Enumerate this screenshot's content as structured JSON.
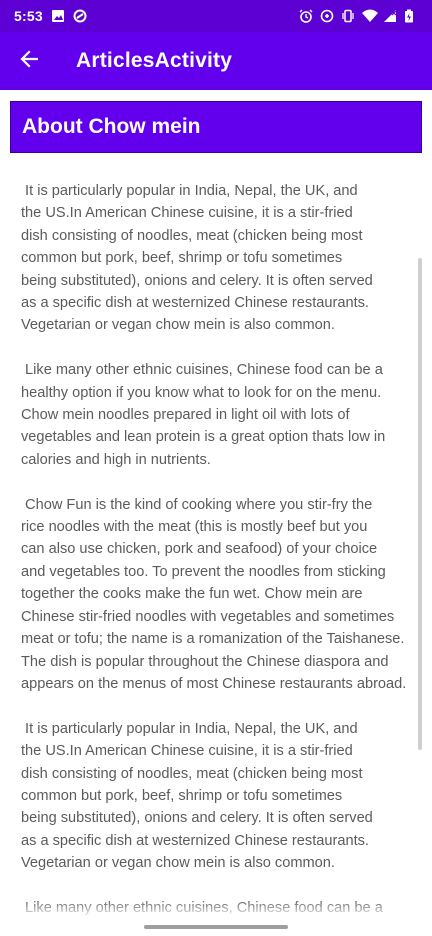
{
  "status_bar": {
    "time": "5:53",
    "icons": [
      "image-icon",
      "data-saver-icon",
      "alarm-icon",
      "data-icon",
      "vibrate-icon",
      "wifi-icon",
      "signal-icon",
      "battery-charging-icon"
    ]
  },
  "app_bar": {
    "title": "ArticlesActivity",
    "back_icon": "arrow-back-icon"
  },
  "article": {
    "heading": "About Chow mein",
    "paragraphs": [
      {
        "lines": [
          " It is particularly popular in India, Nepal, the UK, and",
          "the US.In American Chinese cuisine, it is a stir-fried",
          "dish consisting of noodles, meat (chicken being most",
          "common but pork, beef, shrimp or tofu sometimes",
          "being substituted), onions and celery. It is often served",
          "as a specific dish at westernized Chinese restaurants.",
          "Vegetarian or vegan chow mein is also common."
        ]
      },
      {
        "lines": [
          " Like many other ethnic cuisines, Chinese food can be a",
          "healthy option if you know what to look for on the menu.",
          "Chow mein noodles prepared in light oil with lots of",
          "vegetables and lean protein is a great option thats low in",
          "calories and high in nutrients."
        ]
      },
      {
        "lines": [
          " Chow Fun is the kind of cooking where you stir-fry the",
          "rice noodles with the meat (this is mostly beef but you",
          "can also use chicken, pork and seafood) of your choice",
          "and vegetables too. To prevent the noodles from sticking",
          "together the cooks make the fun wet. Chow mein are",
          "Chinese stir-fried noodles with vegetables and sometimes",
          "meat or tofu; the name is a romanization of the Taishanese.",
          "The dish is popular throughout the Chinese diaspora and",
          "appears on the menus of most Chinese restaurants abroad."
        ]
      },
      {
        "lines": [
          " It is particularly popular in India, Nepal, the UK, and",
          "the US.In American Chinese cuisine, it is a stir-fried",
          "dish consisting of noodles, meat (chicken being most",
          "common but pork, beef, shrimp or tofu sometimes",
          "being substituted), onions and celery. It is often served",
          "as a specific dish at westernized Chinese restaurants.",
          "Vegetarian or vegan chow mein is also common."
        ]
      },
      {
        "lines": [
          " Like many other ethnic cuisines, Chinese food can be a"
        ]
      }
    ]
  },
  "colors": {
    "status_bar": "#5c00d4",
    "app_bar": "#6200ee",
    "heading_card": "#6200ee",
    "body_text": "#5b5b5b"
  }
}
